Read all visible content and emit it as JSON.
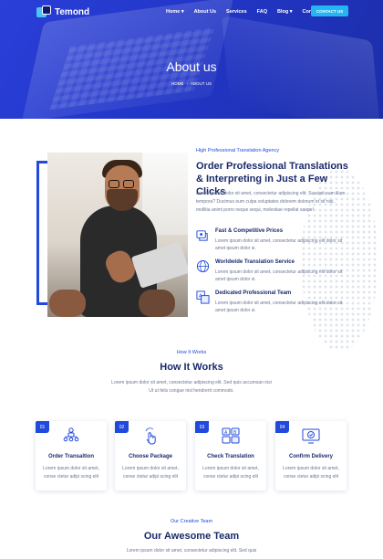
{
  "brand": {
    "name": "Temond"
  },
  "nav": {
    "items": [
      "Home",
      "About Us",
      "Services",
      "FAQ",
      "Blog",
      "Contact"
    ],
    "cta": "CONTACT US"
  },
  "hero": {
    "title": "About us",
    "breadcrumb": [
      "HOME",
      "ABOUT US"
    ]
  },
  "about": {
    "tagline": "High Professional Translation Agency",
    "title": "Order Professional Translations & Interpreting in Just a Few Clicks",
    "description": "Lorem ipsum dolor sit amet, consectetur adipiscing elit. Suscipit eum illum tempora? Ducimus eum culpa voluptates dolorem dolorum et sit nisi, mollitia animi porro neque sequi, molestiae repellat saepe!",
    "features": [
      {
        "title": "Fast & Competitive Prices",
        "text": "Lorem ipsum dolor sit amet, consectetur adipiscing elit dolor sit amet ipsum dolor si.",
        "icon": "price-tag-icon"
      },
      {
        "title": "Worldwide Translation Service",
        "text": "Lorem ipsum dolor sit amet, consectetur adipiscing elit dolor sit amet ipsum dolor si.",
        "icon": "globe-icon"
      },
      {
        "title": "Dedicated Professional Team",
        "text": "Lorem ipsum dolor sit amet, consectetur adipiscing elit dolor sit amet ipsum dolor si.",
        "icon": "translate-icon"
      }
    ]
  },
  "how": {
    "tag": "How It Works",
    "title": "How It Works",
    "description": "Lorem ipsum dolor sit amet, consectetur adipiscing elit. Sed quis accumsan nisi Ut ut felis congue nisl hendrerit commodo.",
    "steps": [
      {
        "num": "01",
        "title": "Order Transaltion",
        "text": "Lorem ipsum dolor sit amet, conse ctetur adipi scing elit",
        "icon": "people-network-icon"
      },
      {
        "num": "02",
        "title": "Choose Package",
        "text": "Lorem ipsum dolor sit amet, conse ctetur adipi scing elit",
        "icon": "hand-touch-icon"
      },
      {
        "num": "03",
        "title": "Check Translation",
        "text": "Lorem ipsum dolor sit amet, conse ctetur adipi scing elit",
        "icon": "language-check-icon"
      },
      {
        "num": "04",
        "title": "Confirm Delivery",
        "text": "Lorem ipsum dolor sit amet, conse ctetur adipi scing elit",
        "icon": "delivery-monitor-icon"
      }
    ]
  },
  "team": {
    "tag": "Our Creative Team",
    "title": "Our Awesome Team",
    "description": "Lorem ipsum dolor sit amet, consectetur adipiscing elit. Sed quis"
  },
  "colors": {
    "primary": "#2149dc",
    "accent": "#22b6f2",
    "heading": "#1a2a6c",
    "text": "#6b7693"
  }
}
